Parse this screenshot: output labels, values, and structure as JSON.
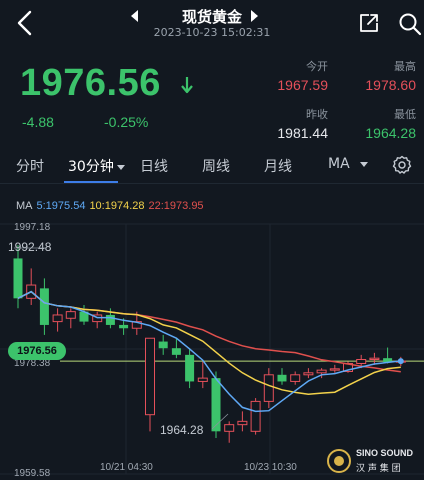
{
  "header": {
    "title": "现货黄金",
    "datetime": "2023-10-23 15:02:31"
  },
  "quote": {
    "price": "1976.56",
    "change": "-4.88",
    "change_pct": "-0.25%",
    "stats": {
      "open_label": "今开",
      "open": "1967.59",
      "high_label": "最高",
      "high": "1978.60",
      "prev_close_label": "昨收",
      "prev_close": "1981.44",
      "low_label": "最低",
      "low": "1964.28"
    }
  },
  "tabs": [
    "分时",
    "30分钟",
    "日线",
    "周线",
    "月线",
    "MA"
  ],
  "active_tab": "30分钟",
  "ma_legend": {
    "title": "MA",
    "ma5": "5:1975.54",
    "ma10": "10:1974.28",
    "ma22": "22:1973.95"
  },
  "chart_labels": {
    "y_top": "1997.18",
    "y_bottom": "1959.58",
    "y_mid": "1978.38",
    "high_mark": "1992.48",
    "low_mark": "1964.28",
    "current": "1976.56",
    "x1": "10/21 04:30",
    "x2": "10/23 10:30"
  },
  "watermark": {
    "line1": "SINO SOUND",
    "line2": "汉 声 集 团"
  },
  "colors": {
    "up": "#e5505a",
    "down": "#3cc36b",
    "ma5": "#5fa9f5",
    "ma10": "#f3d24b",
    "ma22": "#e0504d"
  },
  "chart_data": {
    "type": "candlestick",
    "ylim": [
      1959.58,
      1997.18
    ],
    "candles": [
      {
        "o": 1992.0,
        "h": 1994.0,
        "l": 1984.5,
        "c": 1986.0
      },
      {
        "o": 1986.0,
        "h": 1990.5,
        "l": 1985.0,
        "c": 1988.0
      },
      {
        "o": 1987.5,
        "h": 1989.0,
        "l": 1980.5,
        "c": 1982.0
      },
      {
        "o": 1982.5,
        "h": 1984.5,
        "l": 1981.0,
        "c": 1983.5
      },
      {
        "o": 1983.0,
        "h": 1984.5,
        "l": 1981.5,
        "c": 1984.0
      },
      {
        "o": 1984.0,
        "h": 1985.0,
        "l": 1982.0,
        "c": 1982.5
      },
      {
        "o": 1982.5,
        "h": 1984.0,
        "l": 1981.5,
        "c": 1983.5
      },
      {
        "o": 1983.5,
        "h": 1984.5,
        "l": 1981.5,
        "c": 1982.0
      },
      {
        "o": 1982.0,
        "h": 1983.0,
        "l": 1980.5,
        "c": 1981.5
      },
      {
        "o": 1981.5,
        "h": 1984.0,
        "l": 1980.5,
        "c": 1982.5
      },
      {
        "o": 1968.5,
        "h": 1980.0,
        "l": 1966.0,
        "c": 1980.0
      },
      {
        "o": 1979.5,
        "h": 1980.5,
        "l": 1977.5,
        "c": 1978.5
      },
      {
        "o": 1978.5,
        "h": 1980.0,
        "l": 1977.0,
        "c": 1977.5
      },
      {
        "o": 1977.5,
        "h": 1978.5,
        "l": 1972.5,
        "c": 1973.5
      },
      {
        "o": 1973.5,
        "h": 1976.5,
        "l": 1972.5,
        "c": 1974.0
      },
      {
        "o": 1974.0,
        "h": 1975.0,
        "l": 1965.0,
        "c": 1966.0
      },
      {
        "o": 1966.0,
        "h": 1967.5,
        "l": 1964.28,
        "c": 1967.0
      },
      {
        "o": 1967.0,
        "h": 1969.0,
        "l": 1966.0,
        "c": 1967.5
      },
      {
        "o": 1966.0,
        "h": 1971.0,
        "l": 1965.5,
        "c": 1970.5
      },
      {
        "o": 1970.5,
        "h": 1975.5,
        "l": 1969.5,
        "c": 1974.5
      },
      {
        "o": 1974.5,
        "h": 1975.5,
        "l": 1973.0,
        "c": 1973.5
      },
      {
        "o": 1973.5,
        "h": 1975.0,
        "l": 1973.0,
        "c": 1974.5
      },
      {
        "o": 1974.5,
        "h": 1975.5,
        "l": 1974.0,
        "c": 1974.8
      },
      {
        "o": 1974.8,
        "h": 1975.5,
        "l": 1974.0,
        "c": 1975.2
      },
      {
        "o": 1975.2,
        "h": 1976.0,
        "l": 1974.8,
        "c": 1975.4
      },
      {
        "o": 1975.0,
        "h": 1976.5,
        "l": 1974.8,
        "c": 1976.2
      },
      {
        "o": 1976.2,
        "h": 1977.5,
        "l": 1975.5,
        "c": 1976.8
      },
      {
        "o": 1976.8,
        "h": 1977.8,
        "l": 1976.0,
        "c": 1977.0
      },
      {
        "o": 1977.0,
        "h": 1978.6,
        "l": 1976.2,
        "c": 1976.4
      },
      {
        "o": 1976.4,
        "h": 1977.2,
        "l": 1975.8,
        "c": 1976.56
      }
    ]
  }
}
